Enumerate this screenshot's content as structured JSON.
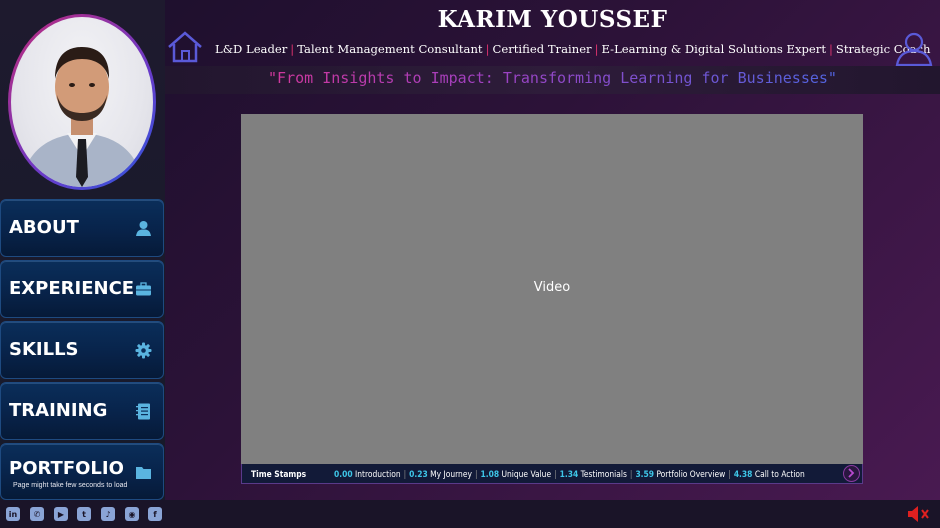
{
  "header": {
    "name": "KARIM YOUSSEF",
    "roles": [
      "L&D Leader",
      "Talent Management Consultant",
      "Certified Trainer",
      "E-Learning & Digital Solutions Expert",
      "Strategic Coach"
    ],
    "role_separator": "|",
    "tagline": "\"From Insights to Impact: Transforming Learning for Businesses\""
  },
  "sidebar": {
    "items": [
      {
        "label": "ABOUT",
        "icon": "user-icon"
      },
      {
        "label": "EXPERIENCE",
        "icon": "briefcase-icon"
      },
      {
        "label": "SKILLS",
        "icon": "gear-icon"
      },
      {
        "label": "TRAINING",
        "icon": "notebook-icon"
      },
      {
        "label": "PORTFOLIO",
        "icon": "folder-icon",
        "note": "Page might take few seconds to load"
      }
    ]
  },
  "video": {
    "label": "Video"
  },
  "timestamps": {
    "title": "Time Stamps",
    "items": [
      {
        "time": "0.00",
        "label": "Introduction"
      },
      {
        "time": "0.23",
        "label": "My Journey"
      },
      {
        "time": "1.08",
        "label": "Unique Value"
      },
      {
        "time": "1.34",
        "label": "Testimonials"
      },
      {
        "time": "3.59",
        "label": "Portfolio Overview"
      },
      {
        "time": "4.38",
        "label": "Call to Action"
      }
    ]
  },
  "social": [
    {
      "icon": "linkedin-icon",
      "glyph": "in"
    },
    {
      "icon": "whatsapp-icon",
      "glyph": "✆"
    },
    {
      "icon": "youtube-icon",
      "glyph": "▶"
    },
    {
      "icon": "twitter-icon",
      "glyph": "t"
    },
    {
      "icon": "tiktok-icon",
      "glyph": "♪"
    },
    {
      "icon": "website-icon",
      "glyph": "◉"
    },
    {
      "icon": "facebook-icon",
      "glyph": "f"
    }
  ],
  "colors": {
    "accent_pink": "#e0336f",
    "accent_cyan": "#3ec6e8",
    "nav_blue": "#0a2e5a",
    "mute_red": "#e02020"
  }
}
